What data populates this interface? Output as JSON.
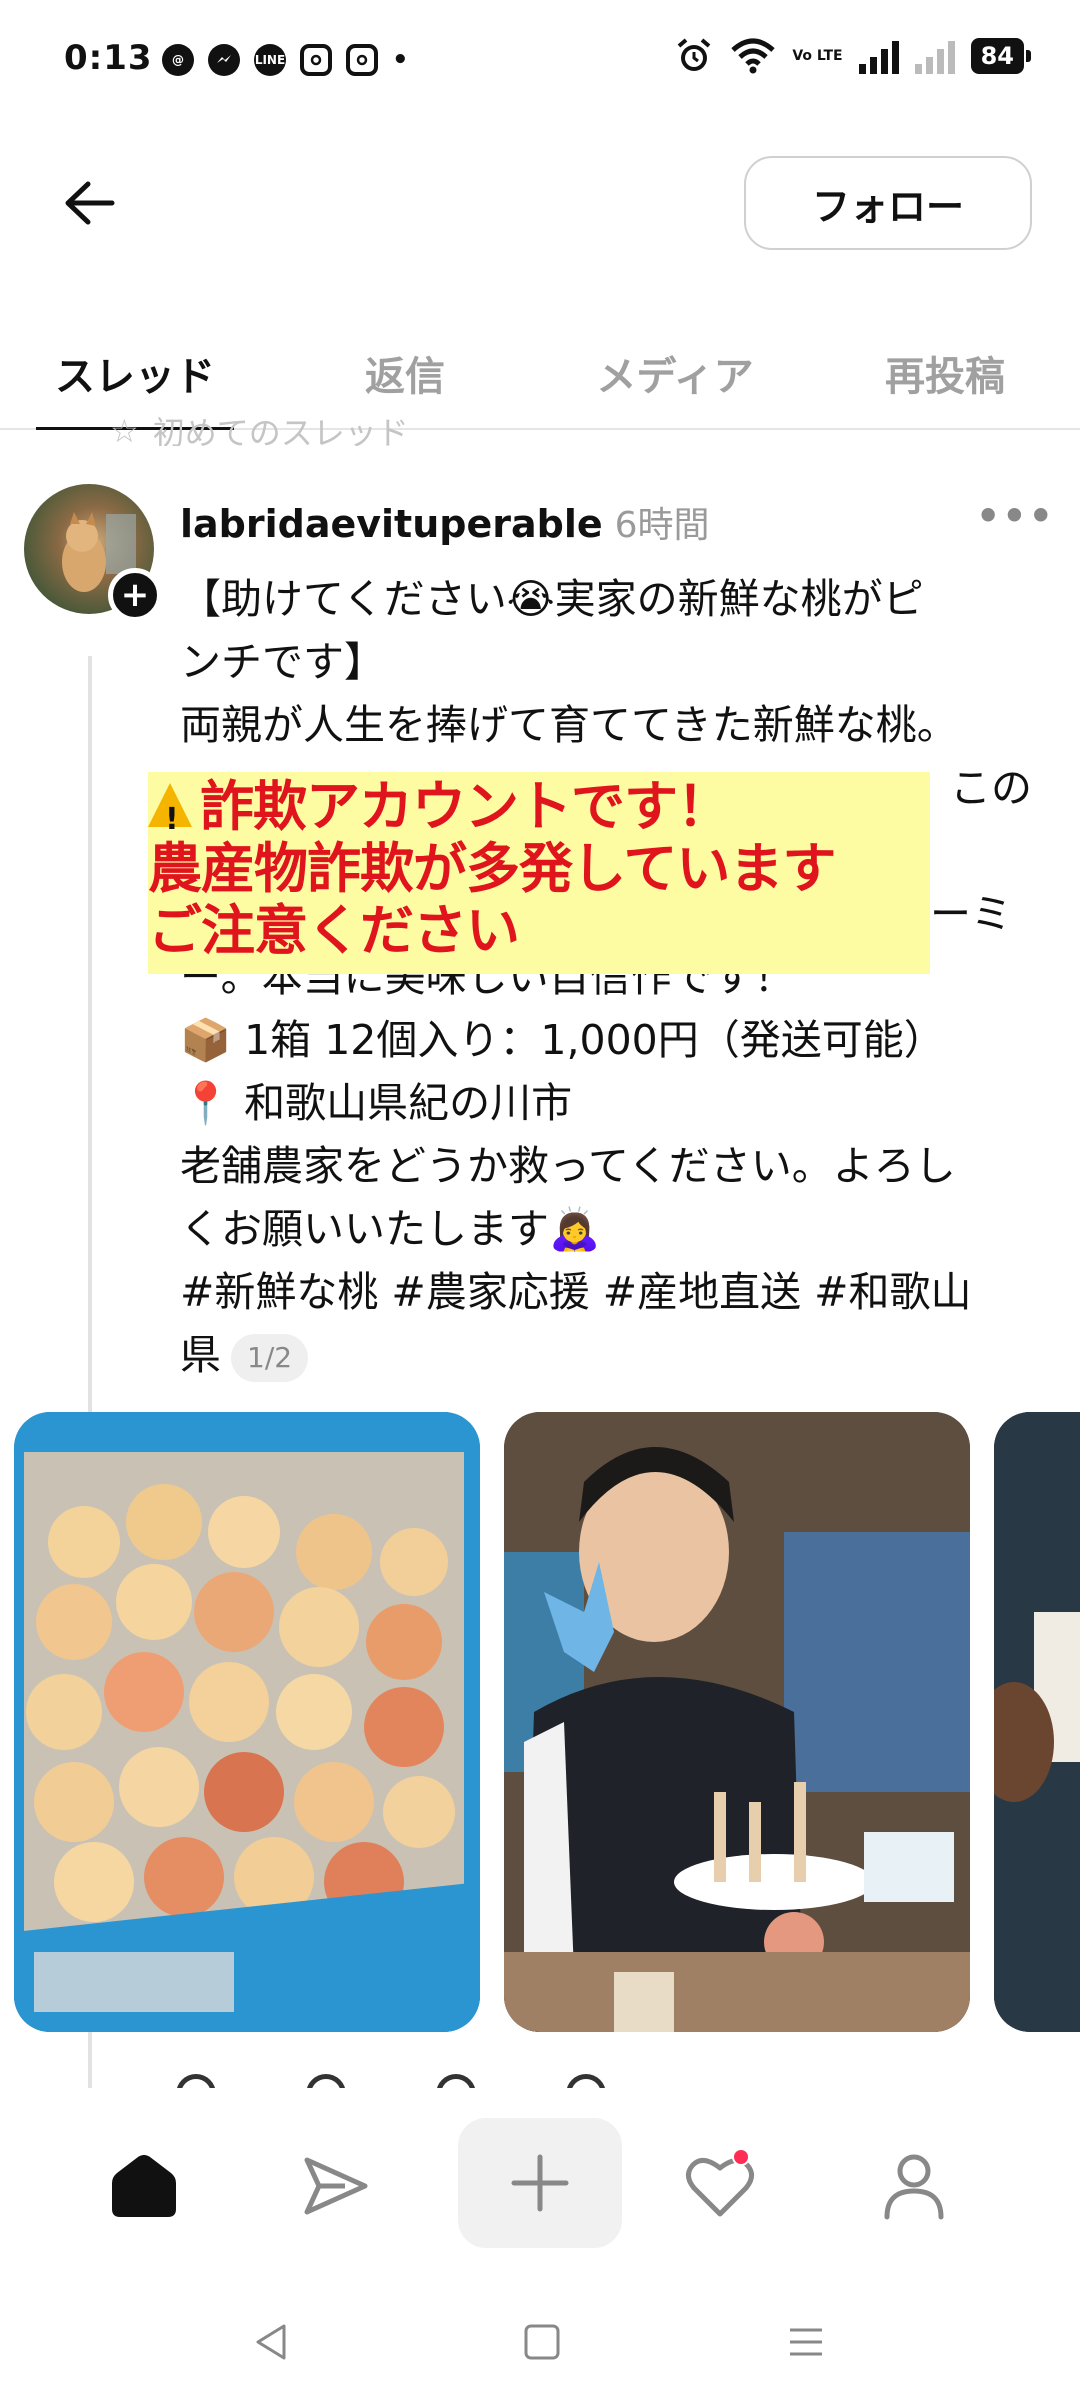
{
  "status_bar": {
    "time": "0:13",
    "apps": [
      "threads",
      "messenger",
      "line",
      "instagram",
      "instagram"
    ],
    "line_label": "LINE",
    "more_dot": "•",
    "volte": "Vo LTE",
    "battery": "84"
  },
  "header": {
    "follow_label": "フォロー"
  },
  "tabs": [
    {
      "label": "スレッド",
      "active": true
    },
    {
      "label": "返信",
      "active": false
    },
    {
      "label": "メディア",
      "active": false
    },
    {
      "label": "再投稿",
      "active": false
    }
  ],
  "pinned_text": "初めてのスレッド",
  "post": {
    "username": "labridaevituperable",
    "time": "6時間",
    "more": "•••",
    "lines": [
      "【助けてください😭実家の新鮮な桃がピ",
      "ンチです】",
      "両親が人生を捧げて育ててきた新鮮な桃。",
      "",
      "",
      "",
      "ー。本当に美味しい自信作です！",
      "📦 1箱 12個入り：1,000円（発送可能）",
      "📍 和歌山県紀の川市",
      "老舗農家をどうか救ってください。よろし",
      "くお願いいたします🙇‍♀️",
      "#新鮮な桃 #農家応援 #産地直送 #和歌山",
      "県"
    ],
    "counter": "1/2"
  },
  "warning_overlay": {
    "line1": "詐欺アカウントです！",
    "line2": "農産物詐欺が多発しています",
    "line3": "ご注意ください"
  },
  "gallery": [
    {
      "name": "peaches-photo",
      "alt": "peaches in blue crate"
    },
    {
      "name": "woman-photo",
      "alt": "woman with peaches"
    },
    {
      "name": "third-photo",
      "alt": "partial photo"
    }
  ],
  "colors": {
    "warning_text": "#e0141c",
    "warning_bg": "#fdfca3",
    "tab_inactive": "#a0a0a0",
    "notif_dot": "#ff2d55"
  }
}
